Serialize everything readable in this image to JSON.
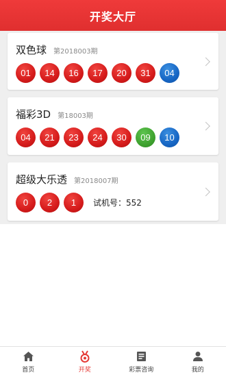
{
  "header": {
    "title": "开奖大厅"
  },
  "colors": {
    "accent": "#e53935",
    "ball_red": "#d51b1b",
    "ball_blue": "#1766c4",
    "ball_green": "#3fa22f"
  },
  "lotteries": [
    {
      "name": "双色球",
      "issue": "第2018003期",
      "balls": [
        {
          "value": "01",
          "color": "red"
        },
        {
          "value": "14",
          "color": "red"
        },
        {
          "value": "16",
          "color": "red"
        },
        {
          "value": "17",
          "color": "red"
        },
        {
          "value": "20",
          "color": "red"
        },
        {
          "value": "31",
          "color": "red"
        },
        {
          "value": "04",
          "color": "blue"
        }
      ],
      "trial": ""
    },
    {
      "name": "福彩3D",
      "issue": "第18003期",
      "balls": [
        {
          "value": "04",
          "color": "red"
        },
        {
          "value": "21",
          "color": "red"
        },
        {
          "value": "23",
          "color": "red"
        },
        {
          "value": "24",
          "color": "red"
        },
        {
          "value": "30",
          "color": "red"
        },
        {
          "value": "09",
          "color": "green"
        },
        {
          "value": "10",
          "color": "blue"
        }
      ],
      "trial": ""
    },
    {
      "name": "超级大乐透",
      "issue": "第2018007期",
      "balls": [
        {
          "value": "0",
          "color": "red"
        },
        {
          "value": "2",
          "color": "red"
        },
        {
          "value": "1",
          "color": "red"
        }
      ],
      "trial": "试机号：552"
    }
  ],
  "tabbar": {
    "items": [
      {
        "label": "首页",
        "icon": "home-icon",
        "active": false
      },
      {
        "label": "开奖",
        "icon": "medal-icon",
        "active": true
      },
      {
        "label": "彩票咨询",
        "icon": "news-icon",
        "active": false
      },
      {
        "label": "我的",
        "icon": "user-icon",
        "active": false
      }
    ]
  }
}
